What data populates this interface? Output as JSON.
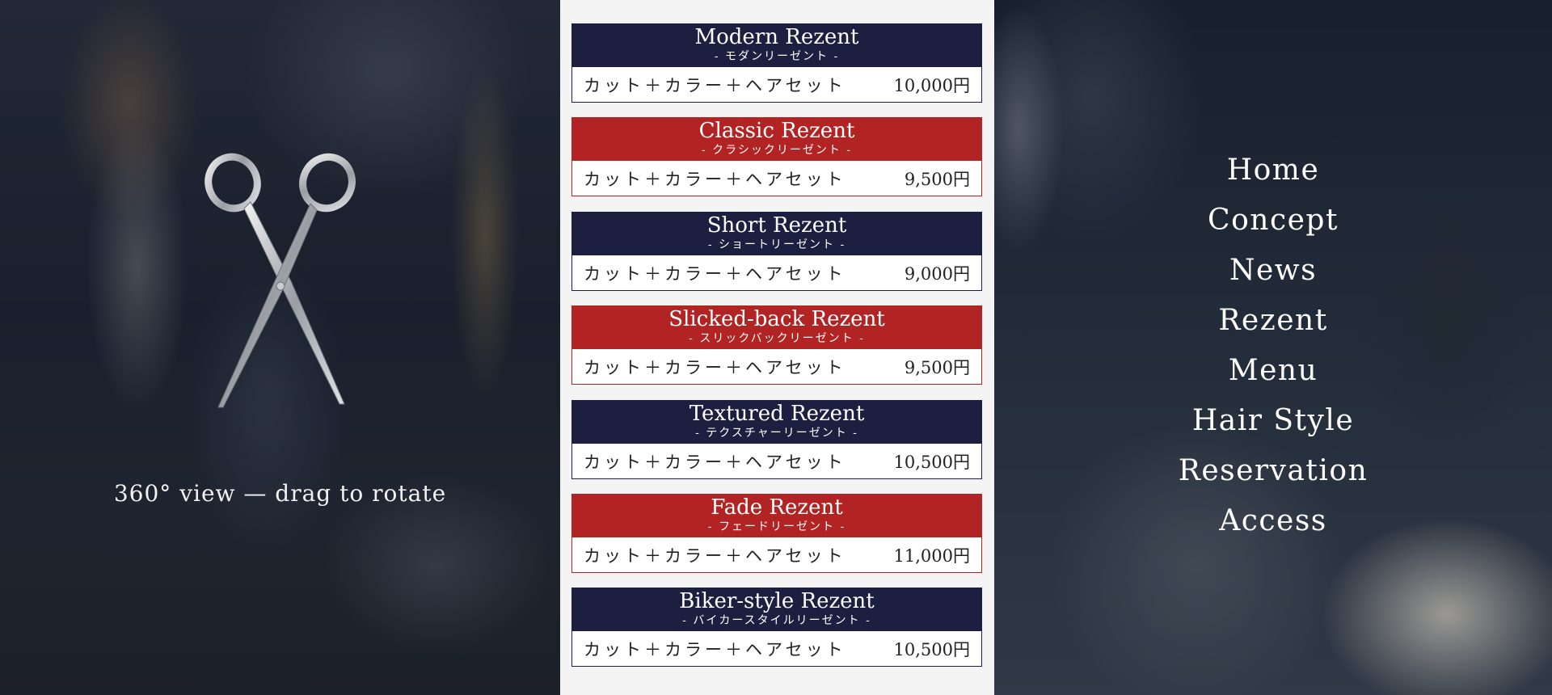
{
  "viewer": {
    "caption": "360° view — drag to rotate"
  },
  "menu": {
    "items": [
      {
        "title": "Modern Rezent",
        "subtitle": "- モダンリーゼント -",
        "desc": "カット＋カラー＋ヘアセット",
        "price": "10,000円",
        "theme": "navy"
      },
      {
        "title": "Classic Rezent",
        "subtitle": "- クラシックリーゼント -",
        "desc": "カット＋カラー＋ヘアセット",
        "price": "9,500円",
        "theme": "red"
      },
      {
        "title": "Short Rezent",
        "subtitle": "- ショートリーゼント -",
        "desc": "カット＋カラー＋ヘアセット",
        "price": "9,000円",
        "theme": "navy"
      },
      {
        "title": "Slicked-back Rezent",
        "subtitle": "- スリックバックリーゼント -",
        "desc": "カット＋カラー＋ヘアセット",
        "price": "9,500円",
        "theme": "red"
      },
      {
        "title": "Textured Rezent",
        "subtitle": "- テクスチャーリーゼント -",
        "desc": "カット＋カラー＋ヘアセット",
        "price": "10,500円",
        "theme": "navy"
      },
      {
        "title": "Fade Rezent",
        "subtitle": "- フェードリーゼント -",
        "desc": "カット＋カラー＋ヘアセット",
        "price": "11,000円",
        "theme": "red"
      },
      {
        "title": "Biker-style Rezent",
        "subtitle": "- バイカースタイルリーゼント -",
        "desc": "カット＋カラー＋ヘアセット",
        "price": "10,500円",
        "theme": "navy"
      }
    ]
  },
  "nav": {
    "items": [
      "Home",
      "Concept",
      "News",
      "Rezent",
      "Menu",
      "Hair Style",
      "Reservation",
      "Access"
    ]
  },
  "colors": {
    "navy": "#1d1f40",
    "red": "#b22323",
    "panel_bg": "#f4f4f4"
  },
  "icons": {
    "viewer": "scissors-icon"
  }
}
